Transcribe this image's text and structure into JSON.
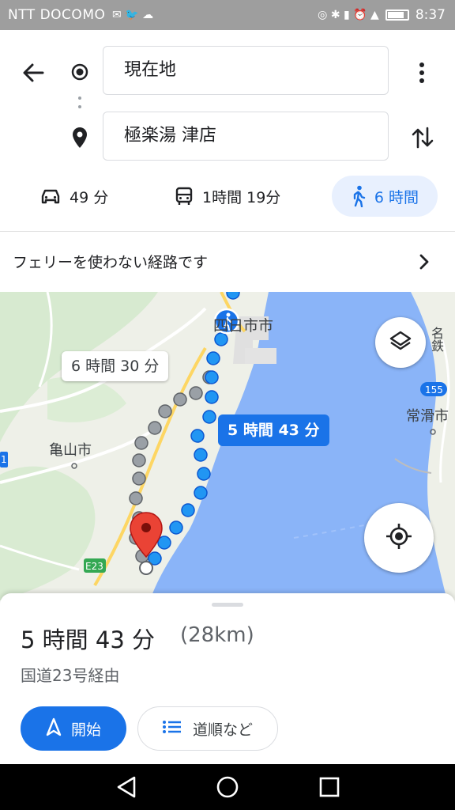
{
  "status_bar": {
    "carrier": "NTT DOCOMO",
    "time": "8:37"
  },
  "route": {
    "origin": "現在地",
    "destination": "極楽湯 津店"
  },
  "modes": [
    {
      "name": "car",
      "label": "49 分"
    },
    {
      "name": "bus",
      "label": "1時間 19分"
    },
    {
      "name": "walk",
      "label": "6 時間",
      "selected": true
    }
  ],
  "ferry_notice": "フェリーを使わない経路です",
  "map": {
    "city_labels": {
      "yokkaichi": "四日市市",
      "kameyama": "亀山市",
      "tokoname": "常滑市",
      "meitetsu": "名鉄"
    },
    "road_badges": {
      "e23": "E23",
      "r155": "155",
      "r1": "1"
    },
    "alt_route_time": "6 時間 30 分",
    "main_route_time": "5 時間 43 分"
  },
  "summary": {
    "duration": "5 時間 43 分",
    "distance": "(28km)",
    "via": "国道23号経由",
    "start_label": "開始",
    "steps_label": "道順など"
  },
  "colors": {
    "accent": "#1a73e8",
    "route_blue": "#2196f3",
    "route_gray": "#9aa0a6",
    "pin_red": "#ea4335",
    "water": "#8ab4f8"
  }
}
